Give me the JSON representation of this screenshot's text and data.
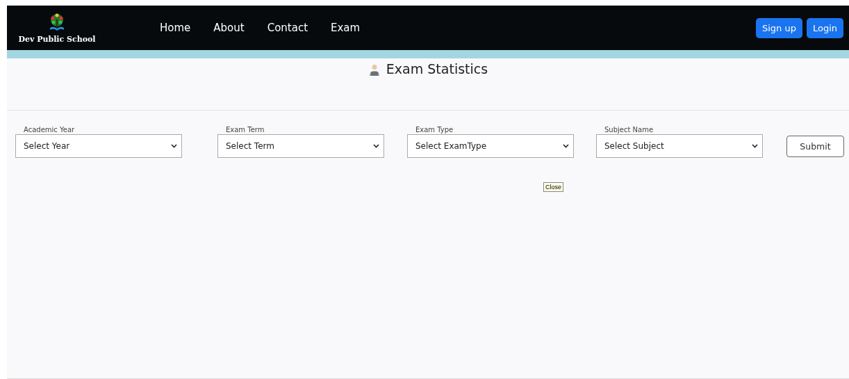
{
  "brand": {
    "name": "Dev Public School"
  },
  "nav": [
    {
      "label": "Home"
    },
    {
      "label": "About"
    },
    {
      "label": "Contact"
    },
    {
      "label": "Exam"
    }
  ],
  "auth_buttons": [
    "Sign up",
    "Login"
  ],
  "page_title": "Exam Statistics",
  "filters": [
    {
      "label": "Academic Year",
      "value": "Select Year"
    },
    {
      "label": "Exam Term",
      "value": "Select Term"
    },
    {
      "label": "Exam Type",
      "value": "Select ExamType"
    },
    {
      "label": "Subject Name",
      "value": "Select Subject"
    }
  ],
  "submit": "Submit",
  "tooltip": "Close"
}
